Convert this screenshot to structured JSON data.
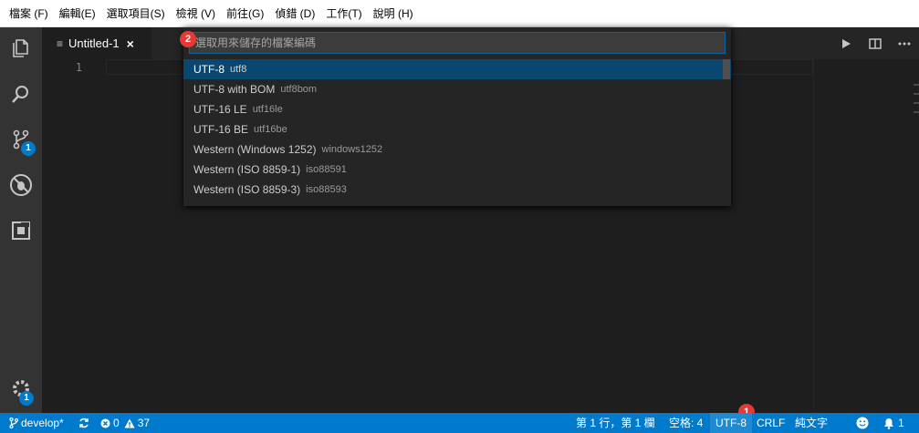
{
  "menubar": {
    "items": [
      "檔案 (F)",
      "編輯(E)",
      "選取項目(S)",
      "檢視 (V)",
      "前往(G)",
      "偵錯 (D)",
      "工作(T)",
      "說明 (H)"
    ]
  },
  "activity_bar": {
    "scm_badge": "1",
    "settings_badge": "1"
  },
  "tab": {
    "title": "Untitled-1",
    "close_glyph": "×",
    "lines_glyph": "≡"
  },
  "editor": {
    "line_number": "1"
  },
  "quick_pick": {
    "placeholder": "選取用來儲存的檔案編碼",
    "items": [
      {
        "label": "UTF-8",
        "desc": "utf8"
      },
      {
        "label": "UTF-8 with BOM",
        "desc": "utf8bom"
      },
      {
        "label": "UTF-16 LE",
        "desc": "utf16le"
      },
      {
        "label": "UTF-16 BE",
        "desc": "utf16be"
      },
      {
        "label": "Western (Windows 1252)",
        "desc": "windows1252"
      },
      {
        "label": "Western (ISO 8859-1)",
        "desc": "iso88591"
      },
      {
        "label": "Western (ISO 8859-3)",
        "desc": "iso88593"
      }
    ]
  },
  "markers": {
    "one": "1",
    "two": "2"
  },
  "statusbar": {
    "branch": "develop*",
    "errors": "0",
    "warnings": "37",
    "position": "第 1 行，第 1 欄",
    "spaces": "空格: 4",
    "encoding": "UTF-8",
    "eol": "CRLF",
    "language": "純文字",
    "notifications": "1"
  },
  "colors": {
    "accent": "#007acc",
    "marker": "#e53935",
    "selection": "#094771"
  }
}
